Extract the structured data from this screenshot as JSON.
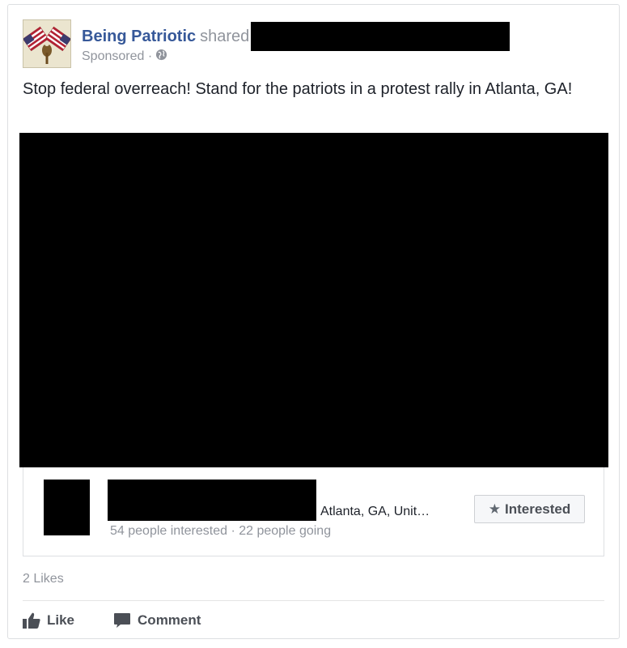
{
  "post": {
    "page_name": "Being Patriotic",
    "shared_text": "shared",
    "sponsored_text": "Sponsored ·",
    "body_text": "Stop federal overreach! Stand for the patriots in a protest rally in Atlanta, GA!"
  },
  "event": {
    "location": "Atlanta, GA, Unit…",
    "stats": "54 people interested · 22 people going",
    "interested_label": "Interested"
  },
  "footer": {
    "likes_count": "2 Likes",
    "like_label": "Like",
    "comment_label": "Comment"
  },
  "icons": {
    "avatar": "american-flags-logo",
    "globe": "globe-icon",
    "star": "star-icon",
    "like": "thumbs-up-icon",
    "comment": "speech-bubble-icon"
  },
  "colors": {
    "link_blue": "#365899",
    "muted_gray": "#90949c",
    "action_gray": "#4b4f56",
    "border": "#dddfe2"
  }
}
